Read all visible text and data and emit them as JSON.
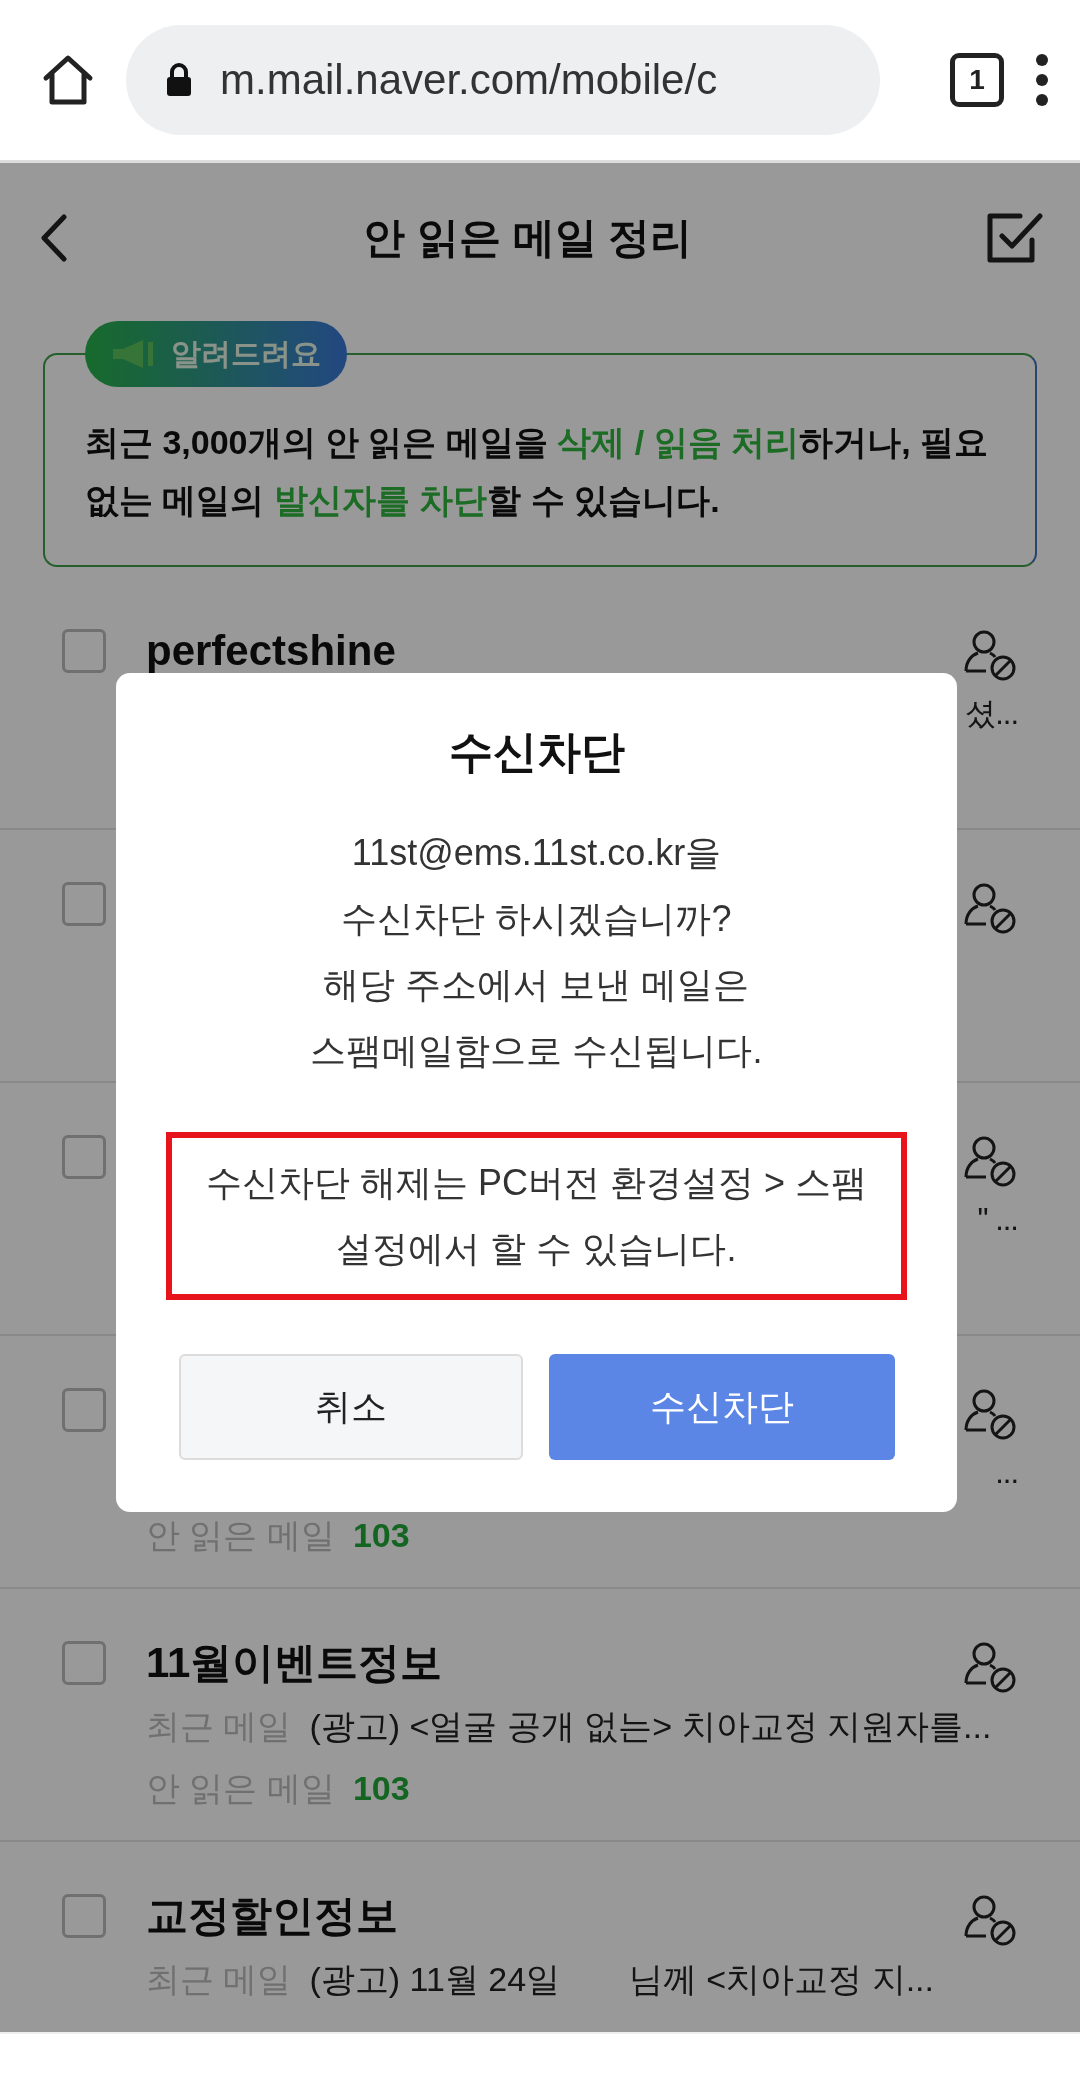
{
  "browser": {
    "url": "m.mail.naver.com/mobile/c",
    "tab_count": "1"
  },
  "header": {
    "title": "안 읽은 메일 정리"
  },
  "notice": {
    "badge": "알려드려요",
    "segments": [
      {
        "text": "최근 3,000개의 안 읽은 메일을 ",
        "highlight": false
      },
      {
        "text": "삭제 / 읽음 처리",
        "highlight": true
      },
      {
        "text": "하거나, 필요 없는 메일의 ",
        "highlight": false
      },
      {
        "text": "발신자를 차단",
        "highlight": true
      },
      {
        "text": "할 수 있습니다.",
        "highlight": false
      }
    ]
  },
  "rows": [
    {
      "checked": false,
      "name": "perfectshine",
      "trailing": "셨..."
    },
    {
      "checked": false
    },
    {
      "checked": false,
      "trailing": "\" ..."
    },
    {
      "checked": false,
      "trailing": "...",
      "unread_label": "안 읽은 메일",
      "unread_count": "103"
    },
    {
      "checked": false,
      "name": "11월이벤트정보",
      "preview_label": "최근 메일",
      "preview": "(광고) <얼굴 공개 없는> 치아교정 지원자를...",
      "unread_label": "안 읽은 메일",
      "unread_count": "103"
    },
    {
      "checked": false,
      "name": "교정할인정보",
      "preview_label": "최근 메일",
      "preview": "(광고) 11월 24일",
      "preview_tail": "님께 <치아교정 지..."
    }
  ],
  "dialog": {
    "title": "수신차단",
    "message": [
      "11st@ems.11st.co.kr을",
      "수신차단 하시겠습니까?",
      "해당 주소에서 보낸 메일은",
      "스팸메일함으로 수신됩니다."
    ],
    "note": "수신차단 해제는 PC버전 환경설정 > 스팸설정에서 할 수 있습니다.",
    "buttons": [
      {
        "label": "취소",
        "kind": "secondary"
      },
      {
        "label": "수신차단",
        "kind": "primary"
      }
    ]
  }
}
